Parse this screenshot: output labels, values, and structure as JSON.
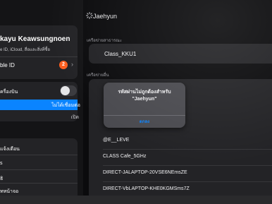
{
  "sidebar": {
    "profile": {
      "name": "kayu Keawsungnoen",
      "subtitle": "e ID, iCloud, สื่อและสิ่งที่ซื้อ",
      "apple_id_label": "ble ID",
      "badge_count": "2"
    },
    "connectivity": {
      "airplane_label": "ครื่องบิน",
      "wifi_status": "ไม่ได้เชื่อมต่อ",
      "bluetooth_status": "เปิด"
    },
    "notifications": {
      "notif_label": "แจ้งเตือน",
      "sounds_label": "s",
      "focus_label": "ธิ",
      "screen_time_label": "ทหน้าจอ"
    }
  },
  "main": {
    "header_title": "Jaehyun",
    "current_section_label": "เครือข่ายสาธารณะ",
    "current_network": "Class_KKU1",
    "other_section_label": "เครือข่ายอื่น",
    "networks": [
      "@E__LEVE",
      "CLASS Cafe_5GHz",
      "DIRECT-JALAPTOP-20VSE6NEmsZE",
      "DIRECT-VbLAPTOP-KHE0KGMSms7Z"
    ]
  },
  "alert": {
    "message_line1": "รหัสผ่านไม่ถูกต้องสำหรับ",
    "message_line2": "\"Jaehyun\"",
    "button_label": "ตกลง"
  },
  "colors": {
    "accent": "#0a84ff",
    "badge": "#ff5f1f"
  }
}
